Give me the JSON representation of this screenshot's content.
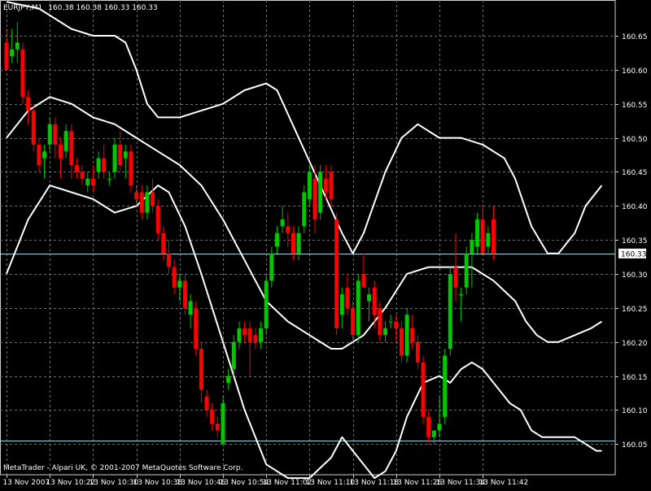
{
  "header": {
    "symbol_timeframe": "EURJPY,M1",
    "ohlc": "160.38 160.38 160.33 160.33"
  },
  "footer": {
    "copyright": "MetaTrader - Alpari UK, © 2001-2007 MetaQuotes Software Corp."
  },
  "colors": {
    "background": "#000000",
    "grid": "#6f6f6f",
    "bull": "#00c800",
    "bear": "#ff0000",
    "bands": "#ffffff",
    "hline": "#9fd9e8",
    "axis_text": "#ffffff"
  },
  "chart_data": {
    "type": "candlestick",
    "symbol": "EURJPY",
    "timeframe": "M1",
    "indicator": "Bollinger Bands",
    "ylim": [
      160.0,
      160.7
    ],
    "y_ticks": [
      160.05,
      160.1,
      160.15,
      160.2,
      160.25,
      160.3,
      160.35,
      160.4,
      160.45,
      160.5,
      160.55,
      160.6,
      160.65
    ],
    "y_tick_labels": [
      "160.05",
      "160.10",
      "160.15",
      "160.20",
      "160.25",
      "160.30",
      "160.35",
      "160.40",
      "160.45",
      "160.50",
      "160.55",
      "160.60",
      "160.65"
    ],
    "x_ticks": [
      {
        "bar": 0,
        "label": "13 Nov 2007"
      },
      {
        "bar": 8,
        "label": "13 Nov 10:22"
      },
      {
        "bar": 16,
        "label": "13 Nov 10:30"
      },
      {
        "bar": 24,
        "label": "13 Nov 10:38"
      },
      {
        "bar": 32,
        "label": "13 Nov 10:46"
      },
      {
        "bar": 40,
        "label": "13 Nov 10:54"
      },
      {
        "bar": 48,
        "label": "13 Nov 11:02"
      },
      {
        "bar": 56,
        "label": "13 Nov 11:10"
      },
      {
        "bar": 64,
        "label": "13 Nov 11:18"
      },
      {
        "bar": 72,
        "label": "13 Nov 11:26"
      },
      {
        "bar": 80,
        "label": "13 Nov 11:34"
      },
      {
        "bar": 88,
        "label": "13 Nov 11:42"
      }
    ],
    "current_price": 160.33,
    "current_price_label": "160.33",
    "horizontal_lines": [
      160.33,
      160.055
    ],
    "candles": [
      {
        "o": 160.64,
        "h": 160.66,
        "l": 160.6,
        "c": 160.6
      },
      {
        "o": 160.62,
        "h": 160.66,
        "l": 160.61,
        "c": 160.63
      },
      {
        "o": 160.63,
        "h": 160.67,
        "l": 160.61,
        "c": 160.64
      },
      {
        "o": 160.63,
        "h": 160.64,
        "l": 160.55,
        "c": 160.56
      },
      {
        "o": 160.56,
        "h": 160.57,
        "l": 160.52,
        "c": 160.54
      },
      {
        "o": 160.54,
        "h": 160.55,
        "l": 160.48,
        "c": 160.49
      },
      {
        "o": 160.49,
        "h": 160.5,
        "l": 160.45,
        "c": 160.46
      },
      {
        "o": 160.47,
        "h": 160.49,
        "l": 160.44,
        "c": 160.48
      },
      {
        "o": 160.49,
        "h": 160.53,
        "l": 160.48,
        "c": 160.52
      },
      {
        "o": 160.52,
        "h": 160.53,
        "l": 160.47,
        "c": 160.49
      },
      {
        "o": 160.49,
        "h": 160.5,
        "l": 160.44,
        "c": 160.47
      },
      {
        "o": 160.48,
        "h": 160.52,
        "l": 160.47,
        "c": 160.51
      },
      {
        "o": 160.51,
        "h": 160.52,
        "l": 160.44,
        "c": 160.46
      },
      {
        "o": 160.46,
        "h": 160.47,
        "l": 160.44,
        "c": 160.45
      },
      {
        "o": 160.45,
        "h": 160.46,
        "l": 160.43,
        "c": 160.44
      },
      {
        "o": 160.43,
        "h": 160.45,
        "l": 160.42,
        "c": 160.44
      },
      {
        "o": 160.44,
        "h": 160.46,
        "l": 160.42,
        "c": 160.43
      },
      {
        "o": 160.45,
        "h": 160.48,
        "l": 160.44,
        "c": 160.47
      },
      {
        "o": 160.47,
        "h": 160.49,
        "l": 160.44,
        "c": 160.45
      },
      {
        "o": 160.44,
        "h": 160.45,
        "l": 160.43,
        "c": 160.44
      },
      {
        "o": 160.45,
        "h": 160.5,
        "l": 160.44,
        "c": 160.49
      },
      {
        "o": 160.49,
        "h": 160.51,
        "l": 160.45,
        "c": 160.46
      },
      {
        "o": 160.47,
        "h": 160.49,
        "l": 160.44,
        "c": 160.48
      },
      {
        "o": 160.48,
        "h": 160.49,
        "l": 160.42,
        "c": 160.43
      },
      {
        "o": 160.42,
        "h": 160.43,
        "l": 160.4,
        "c": 160.41
      },
      {
        "o": 160.42,
        "h": 160.43,
        "l": 160.38,
        "c": 160.39
      },
      {
        "o": 160.39,
        "h": 160.43,
        "l": 160.38,
        "c": 160.42
      },
      {
        "o": 160.42,
        "h": 160.44,
        "l": 160.39,
        "c": 160.4
      },
      {
        "o": 160.4,
        "h": 160.41,
        "l": 160.35,
        "c": 160.36
      },
      {
        "o": 160.36,
        "h": 160.37,
        "l": 160.32,
        "c": 160.33
      },
      {
        "o": 160.33,
        "h": 160.35,
        "l": 160.3,
        "c": 160.31
      },
      {
        "o": 160.31,
        "h": 160.32,
        "l": 160.27,
        "c": 160.28
      },
      {
        "o": 160.28,
        "h": 160.3,
        "l": 160.26,
        "c": 160.29
      },
      {
        "o": 160.29,
        "h": 160.3,
        "l": 160.24,
        "c": 160.25
      },
      {
        "o": 160.24,
        "h": 160.27,
        "l": 160.22,
        "c": 160.26
      },
      {
        "o": 160.25,
        "h": 160.26,
        "l": 160.18,
        "c": 160.19
      },
      {
        "o": 160.19,
        "h": 160.2,
        "l": 160.11,
        "c": 160.13
      },
      {
        "o": 160.12,
        "h": 160.13,
        "l": 160.09,
        "c": 160.1
      },
      {
        "o": 160.1,
        "h": 160.11,
        "l": 160.07,
        "c": 160.08
      },
      {
        "o": 160.08,
        "h": 160.09,
        "l": 160.06,
        "c": 160.07
      },
      {
        "o": 160.05,
        "h": 160.12,
        "l": 160.05,
        "c": 160.11
      },
      {
        "o": 160.14,
        "h": 160.16,
        "l": 160.13,
        "c": 160.15
      },
      {
        "o": 160.16,
        "h": 160.21,
        "l": 160.15,
        "c": 160.2
      },
      {
        "o": 160.2,
        "h": 160.23,
        "l": 160.19,
        "c": 160.22
      },
      {
        "o": 160.22,
        "h": 160.23,
        "l": 160.2,
        "c": 160.21
      },
      {
        "o": 160.22,
        "h": 160.23,
        "l": 160.15,
        "c": 160.2
      },
      {
        "o": 160.21,
        "h": 160.22,
        "l": 160.19,
        "c": 160.2
      },
      {
        "o": 160.2,
        "h": 160.23,
        "l": 160.19,
        "c": 160.22
      },
      {
        "o": 160.22,
        "h": 160.3,
        "l": 160.21,
        "c": 160.29
      },
      {
        "o": 160.29,
        "h": 160.34,
        "l": 160.28,
        "c": 160.33
      },
      {
        "o": 160.34,
        "h": 160.37,
        "l": 160.33,
        "c": 160.36
      },
      {
        "o": 160.37,
        "h": 160.4,
        "l": 160.36,
        "c": 160.38
      },
      {
        "o": 160.37,
        "h": 160.39,
        "l": 160.34,
        "c": 160.36
      },
      {
        "o": 160.36,
        "h": 160.37,
        "l": 160.32,
        "c": 160.33
      },
      {
        "o": 160.33,
        "h": 160.37,
        "l": 160.32,
        "c": 160.36
      },
      {
        "o": 160.37,
        "h": 160.43,
        "l": 160.36,
        "c": 160.42
      },
      {
        "o": 160.41,
        "h": 160.46,
        "l": 160.4,
        "c": 160.45
      },
      {
        "o": 160.44,
        "h": 160.46,
        "l": 160.36,
        "c": 160.38
      },
      {
        "o": 160.39,
        "h": 160.46,
        "l": 160.38,
        "c": 160.45
      },
      {
        "o": 160.44,
        "h": 160.46,
        "l": 160.41,
        "c": 160.42
      },
      {
        "o": 160.45,
        "h": 160.46,
        "l": 160.4,
        "c": 160.41
      },
      {
        "o": 160.38,
        "h": 160.39,
        "l": 160.21,
        "c": 160.22
      },
      {
        "o": 160.24,
        "h": 160.28,
        "l": 160.22,
        "c": 160.27
      },
      {
        "o": 160.28,
        "h": 160.3,
        "l": 160.24,
        "c": 160.25
      },
      {
        "o": 160.25,
        "h": 160.26,
        "l": 160.2,
        "c": 160.21
      },
      {
        "o": 160.21,
        "h": 160.3,
        "l": 160.2,
        "c": 160.29
      },
      {
        "o": 160.3,
        "h": 160.33,
        "l": 160.28,
        "c": 160.28
      },
      {
        "o": 160.26,
        "h": 160.28,
        "l": 160.23,
        "c": 160.27
      },
      {
        "o": 160.28,
        "h": 160.29,
        "l": 160.22,
        "c": 160.24
      },
      {
        "o": 160.25,
        "h": 160.26,
        "l": 160.2,
        "c": 160.21
      },
      {
        "o": 160.21,
        "h": 160.23,
        "l": 160.2,
        "c": 160.22
      },
      {
        "o": 160.23,
        "h": 160.24,
        "l": 160.22,
        "c": 160.23
      },
      {
        "o": 160.23,
        "h": 160.24,
        "l": 160.2,
        "c": 160.22
      },
      {
        "o": 160.22,
        "h": 160.23,
        "l": 160.17,
        "c": 160.18
      },
      {
        "o": 160.18,
        "h": 160.25,
        "l": 160.17,
        "c": 160.24
      },
      {
        "o": 160.22,
        "h": 160.24,
        "l": 160.19,
        "c": 160.2
      },
      {
        "o": 160.2,
        "h": 160.21,
        "l": 160.16,
        "c": 160.17
      },
      {
        "o": 160.17,
        "h": 160.18,
        "l": 160.08,
        "c": 160.09
      },
      {
        "o": 160.09,
        "h": 160.1,
        "l": 160.05,
        "c": 160.06
      },
      {
        "o": 160.06,
        "h": 160.07,
        "l": 160.05,
        "c": 160.07
      },
      {
        "o": 160.07,
        "h": 160.12,
        "l": 160.06,
        "c": 160.08
      },
      {
        "o": 160.09,
        "h": 160.19,
        "l": 160.08,
        "c": 160.18
      },
      {
        "o": 160.19,
        "h": 160.31,
        "l": 160.18,
        "c": 160.3
      },
      {
        "o": 160.31,
        "h": 160.36,
        "l": 160.26,
        "c": 160.28
      },
      {
        "o": 160.27,
        "h": 160.28,
        "l": 160.23,
        "c": 160.27
      },
      {
        "o": 160.28,
        "h": 160.34,
        "l": 160.27,
        "c": 160.33
      },
      {
        "o": 160.33,
        "h": 160.36,
        "l": 160.28,
        "c": 160.35
      },
      {
        "o": 160.34,
        "h": 160.39,
        "l": 160.33,
        "c": 160.38
      },
      {
        "o": 160.38,
        "h": 160.4,
        "l": 160.33,
        "c": 160.33
      },
      {
        "o": 160.34,
        "h": 160.37,
        "l": 160.33,
        "c": 160.36
      },
      {
        "o": 160.38,
        "h": 160.4,
        "l": 160.32,
        "c": 160.33
      }
    ],
    "bands": {
      "upper": [
        [
          0,
          160.7
        ],
        [
          6,
          160.69
        ],
        [
          12,
          160.66
        ],
        [
          16,
          160.65
        ],
        [
          20,
          160.65
        ],
        [
          22,
          160.64
        ],
        [
          24,
          160.6
        ],
        [
          26,
          160.55
        ],
        [
          28,
          160.53
        ],
        [
          32,
          160.53
        ],
        [
          36,
          160.54
        ],
        [
          40,
          160.55
        ],
        [
          44,
          160.57
        ],
        [
          48,
          160.58
        ],
        [
          50,
          160.57
        ],
        [
          54,
          160.5
        ],
        [
          58,
          160.43
        ],
        [
          62,
          160.36
        ],
        [
          64,
          160.33
        ],
        [
          66,
          160.36
        ],
        [
          70,
          160.45
        ],
        [
          73,
          160.5
        ],
        [
          76,
          160.52
        ],
        [
          80,
          160.5
        ],
        [
          84,
          160.5
        ],
        [
          88,
          160.49
        ],
        [
          92,
          160.47
        ],
        [
          94,
          160.44
        ],
        [
          97,
          160.37
        ],
        [
          100,
          160.33
        ],
        [
          102,
          160.33
        ],
        [
          105,
          160.36
        ],
        [
          107,
          160.4
        ],
        [
          110,
          160.43
        ]
      ],
      "middle": [
        [
          0,
          160.5
        ],
        [
          4,
          160.54
        ],
        [
          8,
          160.56
        ],
        [
          12,
          160.55
        ],
        [
          16,
          160.53
        ],
        [
          20,
          160.52
        ],
        [
          24,
          160.5
        ],
        [
          28,
          160.48
        ],
        [
          32,
          160.46
        ],
        [
          36,
          160.43
        ],
        [
          40,
          160.38
        ],
        [
          44,
          160.32
        ],
        [
          48,
          160.26
        ],
        [
          52,
          160.23
        ],
        [
          56,
          160.21
        ],
        [
          60,
          160.19
        ],
        [
          62,
          160.19
        ],
        [
          66,
          160.21
        ],
        [
          70,
          160.25
        ],
        [
          74,
          160.3
        ],
        [
          78,
          160.31
        ],
        [
          82,
          160.31
        ],
        [
          86,
          160.31
        ],
        [
          90,
          160.29
        ],
        [
          94,
          160.26
        ],
        [
          96,
          160.23
        ],
        [
          98,
          160.21
        ],
        [
          100,
          160.2
        ],
        [
          102,
          160.2
        ],
        [
          105,
          160.21
        ],
        [
          108,
          160.22
        ],
        [
          110,
          160.23
        ]
      ],
      "lower": [
        [
          0,
          160.3
        ],
        [
          4,
          160.38
        ],
        [
          8,
          160.43
        ],
        [
          12,
          160.42
        ],
        [
          16,
          160.41
        ],
        [
          20,
          160.39
        ],
        [
          24,
          160.4
        ],
        [
          28,
          160.43
        ],
        [
          30,
          160.42
        ],
        [
          33,
          160.37
        ],
        [
          36,
          160.3
        ],
        [
          40,
          160.2
        ],
        [
          44,
          160.1
        ],
        [
          48,
          160.02
        ],
        [
          52,
          160.0
        ],
        [
          56,
          160.0
        ],
        [
          60,
          160.03
        ],
        [
          62,
          160.06
        ],
        [
          64,
          160.04
        ],
        [
          68,
          160.0
        ],
        [
          70,
          160.01
        ],
        [
          72,
          160.04
        ],
        [
          74,
          160.09
        ],
        [
          77,
          160.14
        ],
        [
          80,
          160.15
        ],
        [
          82,
          160.14
        ],
        [
          84,
          160.16
        ],
        [
          86,
          160.17
        ],
        [
          88,
          160.16
        ],
        [
          90,
          160.14
        ],
        [
          93,
          160.11
        ],
        [
          95,
          160.1
        ],
        [
          97,
          160.07
        ],
        [
          99,
          160.06
        ],
        [
          102,
          160.06
        ],
        [
          105,
          160.06
        ],
        [
          107,
          160.05
        ],
        [
          109,
          160.04
        ],
        [
          110,
          160.04
        ]
      ]
    }
  }
}
